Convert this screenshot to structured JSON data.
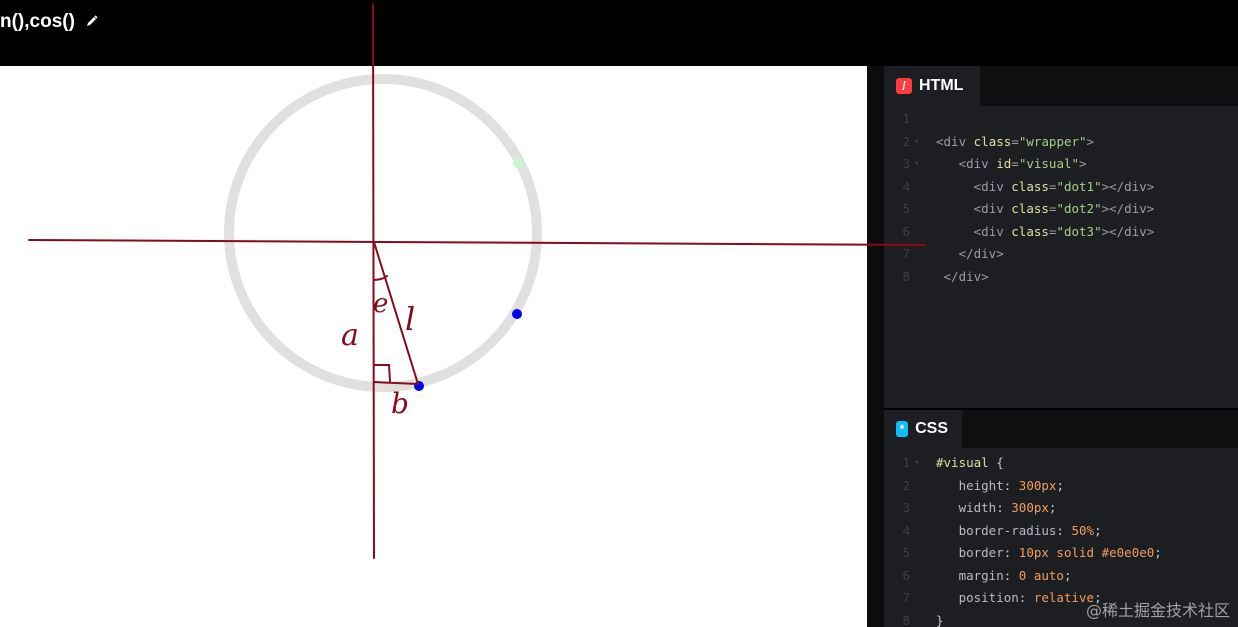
{
  "header": {
    "title": "n(),cos()",
    "edit_icon": "pencil-icon"
  },
  "preview": {
    "circle_border_color": "#e0e0e0",
    "dot_colors": {
      "dot1": "#c8f5cf",
      "dot2": "#0000ee",
      "dot3": "#0000ee"
    },
    "annotation_color": "#8b0a1a",
    "annotations": {
      "theta": "e",
      "hyp": "l",
      "adj": "a",
      "opp": "b"
    }
  },
  "html_panel": {
    "tab_label": "HTML",
    "badge": "/",
    "lines": [
      {
        "n": "1",
        "fold": "",
        "tokens": []
      },
      {
        "n": "2",
        "fold": "▾",
        "tokens": [
          [
            "c-tag",
            "<div "
          ],
          [
            "c-attr",
            "class"
          ],
          [
            "c-tag",
            "="
          ],
          [
            "c-str",
            "\"wrapper\""
          ],
          [
            "c-tag",
            ">"
          ]
        ]
      },
      {
        "n": "3",
        "fold": "▾",
        "tokens": [
          [
            "c-plain",
            "   "
          ],
          [
            "c-tag",
            "<div "
          ],
          [
            "c-attr",
            "id"
          ],
          [
            "c-tag",
            "="
          ],
          [
            "c-str",
            "\"visual\""
          ],
          [
            "c-tag",
            ">"
          ]
        ]
      },
      {
        "n": "4",
        "fold": "",
        "tokens": [
          [
            "c-plain",
            "     "
          ],
          [
            "c-tag",
            "<div "
          ],
          [
            "c-attr",
            "class"
          ],
          [
            "c-tag",
            "="
          ],
          [
            "c-str",
            "\"dot1\""
          ],
          [
            "c-tag",
            "></div>"
          ]
        ]
      },
      {
        "n": "5",
        "fold": "",
        "tokens": [
          [
            "c-plain",
            "     "
          ],
          [
            "c-tag",
            "<div "
          ],
          [
            "c-attr",
            "class"
          ],
          [
            "c-tag",
            "="
          ],
          [
            "c-str",
            "\"dot2\""
          ],
          [
            "c-tag",
            "></div>"
          ]
        ]
      },
      {
        "n": "6",
        "fold": "",
        "tokens": [
          [
            "c-plain",
            "     "
          ],
          [
            "c-tag",
            "<div "
          ],
          [
            "c-attr",
            "class"
          ],
          [
            "c-tag",
            "="
          ],
          [
            "c-str",
            "\"dot3\""
          ],
          [
            "c-tag",
            "></div>"
          ]
        ]
      },
      {
        "n": "7",
        "fold": "",
        "tokens": [
          [
            "c-plain",
            "   "
          ],
          [
            "c-tag",
            "</div>"
          ]
        ]
      },
      {
        "n": "8",
        "fold": "",
        "tokens": [
          [
            "c-plain",
            " "
          ],
          [
            "c-tag",
            "</div>"
          ]
        ]
      }
    ]
  },
  "css_panel": {
    "tab_label": "CSS",
    "badge": "*",
    "lines": [
      {
        "n": "1",
        "fold": "▾",
        "tokens": [
          [
            "c-sel",
            "#visual"
          ],
          [
            "c-plain",
            " {"
          ]
        ]
      },
      {
        "n": "2",
        "fold": "",
        "tokens": [
          [
            "c-plain",
            "   "
          ],
          [
            "c-prop",
            "height"
          ],
          [
            "c-plain",
            ": "
          ],
          [
            "c-num",
            "300px"
          ],
          [
            "c-plain",
            ";"
          ]
        ]
      },
      {
        "n": "3",
        "fold": "",
        "tokens": [
          [
            "c-plain",
            "   "
          ],
          [
            "c-prop",
            "width"
          ],
          [
            "c-plain",
            ": "
          ],
          [
            "c-num",
            "300px"
          ],
          [
            "c-plain",
            ";"
          ]
        ]
      },
      {
        "n": "4",
        "fold": "",
        "tokens": [
          [
            "c-plain",
            "   "
          ],
          [
            "c-prop",
            "border-radius"
          ],
          [
            "c-plain",
            ": "
          ],
          [
            "c-num",
            "50%"
          ],
          [
            "c-plain",
            ";"
          ]
        ]
      },
      {
        "n": "5",
        "fold": "",
        "tokens": [
          [
            "c-plain",
            "   "
          ],
          [
            "c-prop",
            "border"
          ],
          [
            "c-plain",
            ": "
          ],
          [
            "c-num",
            "10px"
          ],
          [
            "c-kw",
            " solid"
          ],
          [
            "c-plain",
            " "
          ],
          [
            "c-num",
            "#e0e0e0"
          ],
          [
            "c-plain",
            ";"
          ]
        ]
      },
      {
        "n": "6",
        "fold": "",
        "tokens": [
          [
            "c-plain",
            "   "
          ],
          [
            "c-prop",
            "margin"
          ],
          [
            "c-plain",
            ": "
          ],
          [
            "c-num",
            "0"
          ],
          [
            "c-kw",
            " auto"
          ],
          [
            "c-plain",
            ";"
          ]
        ]
      },
      {
        "n": "7",
        "fold": "",
        "tokens": [
          [
            "c-plain",
            "   "
          ],
          [
            "c-prop",
            "position"
          ],
          [
            "c-plain",
            ": "
          ],
          [
            "c-kw",
            "relative"
          ],
          [
            "c-plain",
            ";"
          ]
        ]
      },
      {
        "n": "8",
        "fold": "",
        "tokens": [
          [
            "c-plain",
            "}"
          ]
        ]
      }
    ]
  },
  "watermark": "@稀土掘金技术社区"
}
